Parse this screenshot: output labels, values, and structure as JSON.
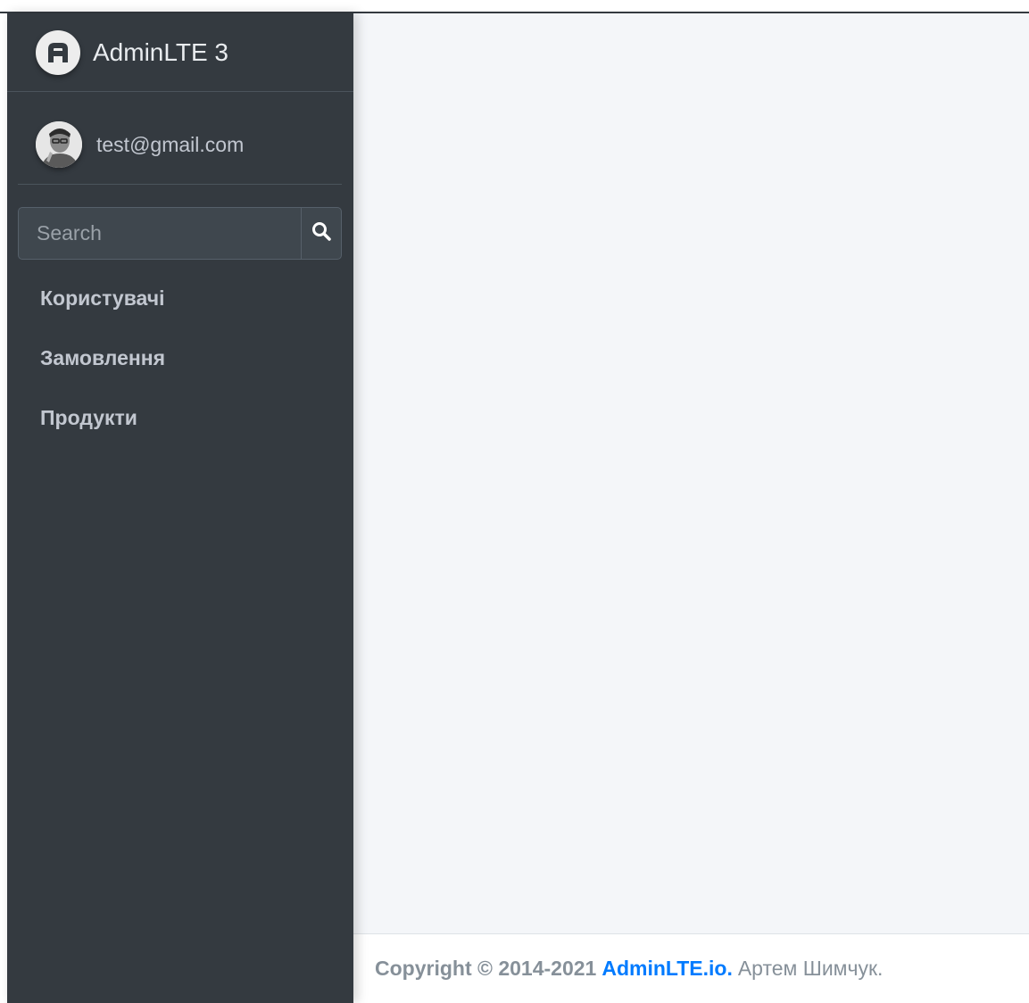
{
  "brand": {
    "title": "AdminLTE 3",
    "logo_icon": "adminlte-logo-icon"
  },
  "user": {
    "email": "test@gmail.com",
    "avatar": "user-avatar"
  },
  "search": {
    "placeholder": "Search",
    "icon": "search-icon"
  },
  "nav": {
    "items": [
      {
        "label": "Користувачі"
      },
      {
        "label": "Замовлення"
      },
      {
        "label": "Продукти"
      }
    ]
  },
  "footer": {
    "copyright": "Copyright © 2014-2021",
    "link_text": "AdminLTE.io.",
    "author": "Артем Шимчук."
  },
  "colors": {
    "sidebar_bg": "#343a40",
    "content_bg": "#f4f6f9",
    "link": "#007bff"
  }
}
